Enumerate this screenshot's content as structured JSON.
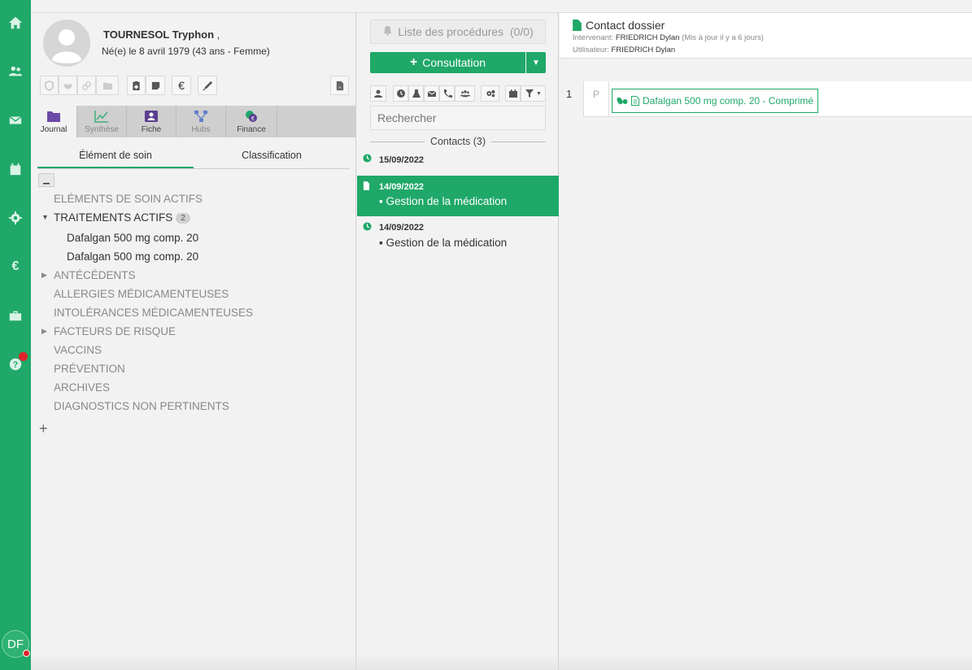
{
  "nav": {
    "icons": [
      "home-icon",
      "users-icon",
      "mail-icon",
      "calendar-icon",
      "gear-icon",
      "euro-icon",
      "briefcase-icon",
      "help-icon"
    ],
    "avatar_initials": "DF"
  },
  "patient": {
    "name": "TOURNESOL Tryphon",
    "name_suffix": ",",
    "birth": "Né(e) le 8 avril 1979 (43 ans - Femme)",
    "euro_symbol": "€"
  },
  "tabs": [
    {
      "label": "Journal",
      "icon": "folder-icon"
    },
    {
      "label": "Synthèse",
      "icon": "chart-icon"
    },
    {
      "label": "Fiche",
      "icon": "id-card-icon"
    },
    {
      "label": "Hubs",
      "icon": "network-icon"
    },
    {
      "label": "Finance",
      "icon": "finance-icon"
    }
  ],
  "subtabs": [
    "Élément de soin",
    "Classification"
  ],
  "tree": {
    "actifs": "ELÉMENTS DE SOIN ACTIFS",
    "traitements": "TRAITEMENTS ACTIFS",
    "traitements_count": "2",
    "traitement_items": [
      "Dafalgan 500 mg comp. 20",
      "Dafalgan 500 mg comp. 20"
    ],
    "antecedents": "ANTÉCÉDENTS",
    "allergies": "ALLERGIES MÉDICAMENTEUSES",
    "intolerances": "INTOLÉRANCES MÉDICAMENTEUSES",
    "facteurs": "FACTEURS DE RISQUE",
    "vaccins": "VACCINS",
    "prevention": "PRÉVENTION",
    "archives": "ARCHIVES",
    "diagnostics": "DIAGNOSTICS NON PERTINENTS",
    "add": "+"
  },
  "middle": {
    "procedures_label": "Liste des procédures",
    "procedures_count": "(0/0)",
    "consultation_label": "Consultation",
    "search_placeholder": "Rechercher",
    "contacts_header": "Contacts (3)",
    "contacts": [
      {
        "date": "15/09/2022",
        "desc": ""
      },
      {
        "date": "14/09/2022",
        "desc": "Gestion de la médication"
      },
      {
        "date": "14/09/2022",
        "desc": "Gestion de la médication"
      }
    ]
  },
  "right": {
    "title": "Contact dossier",
    "intervenant_label": "Intervenant:",
    "intervenant_value": "FRIEDRICH Dylan",
    "intervenant_meta": "(Mis à jour il y a 6 jours)",
    "utilisateur_label": "Utilisateur:",
    "utilisateur_value": "FRIEDRICH Dylan",
    "row_number": "1",
    "row_type": "P",
    "medication": "Dafalgan 500 mg comp. 20 - Comprimé"
  },
  "colors": {
    "accent": "#1fa868",
    "alert": "#e0232d"
  }
}
